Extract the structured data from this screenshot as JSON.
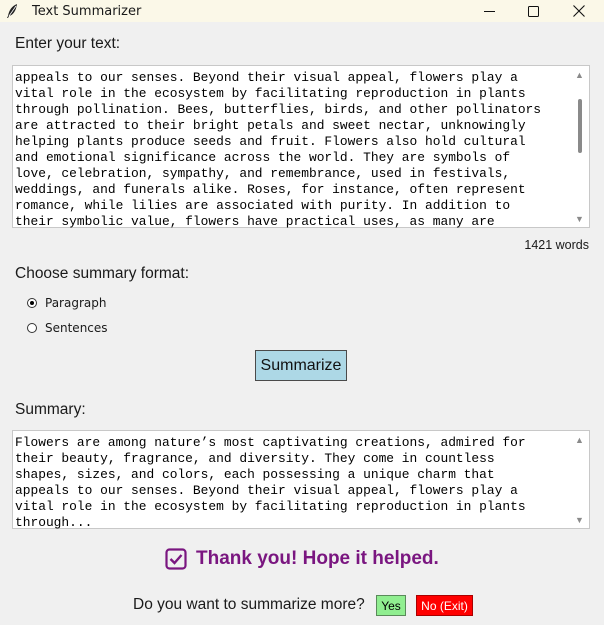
{
  "window": {
    "title": "Text Summarizer"
  },
  "input": {
    "label": "Enter your text:",
    "lines": [
      "appeals to our senses. Beyond their visual appeal, flowers play a",
      "vital role in the ecosystem by facilitating reproduction in plants",
      "through pollination. Bees, butterflies, birds, and other pollinators",
      "are attracted to their bright petals and sweet nectar, unknowingly",
      "helping plants produce seeds and fruit. Flowers also hold cultural",
      "and emotional significance across the world. They are symbols of",
      "love, celebration, sympathy, and remembrance, used in festivals,",
      "weddings, and funerals alike. Roses, for instance, often represent",
      "romance, while lilies are associated with purity. In addition to",
      "their symbolic value, flowers have practical uses, as many are"
    ],
    "word_count": "1421 words"
  },
  "format": {
    "label": "Choose summary format:",
    "options": [
      "Paragraph",
      "Sentences"
    ],
    "selected": "Paragraph"
  },
  "summarize_button": "Summarize",
  "summary": {
    "label": "Summary:",
    "lines": [
      "Flowers are among nature’s most captivating creations, admired for",
      "their beauty, fragrance, and diversity. They come in countless",
      "shapes, sizes, and colors, each possessing a unique charm that",
      "appeals to our senses. Beyond their visual appeal, flowers play a",
      "vital role in the ecosystem by facilitating reproduction in plants",
      "through..."
    ]
  },
  "thanks": "Thank you! Hope it helped.",
  "prompt": {
    "question": "Do you want to summarize more?",
    "yes_label": "Yes",
    "no_label": "No (Exit)"
  },
  "icons": {
    "app": "feather-icon",
    "check": "checkbox-check-icon"
  },
  "colors": {
    "thanks": "#7a1680",
    "summarize_button": "#add8e6",
    "yes_button": "#90ee90",
    "no_button": "#ff0000"
  }
}
